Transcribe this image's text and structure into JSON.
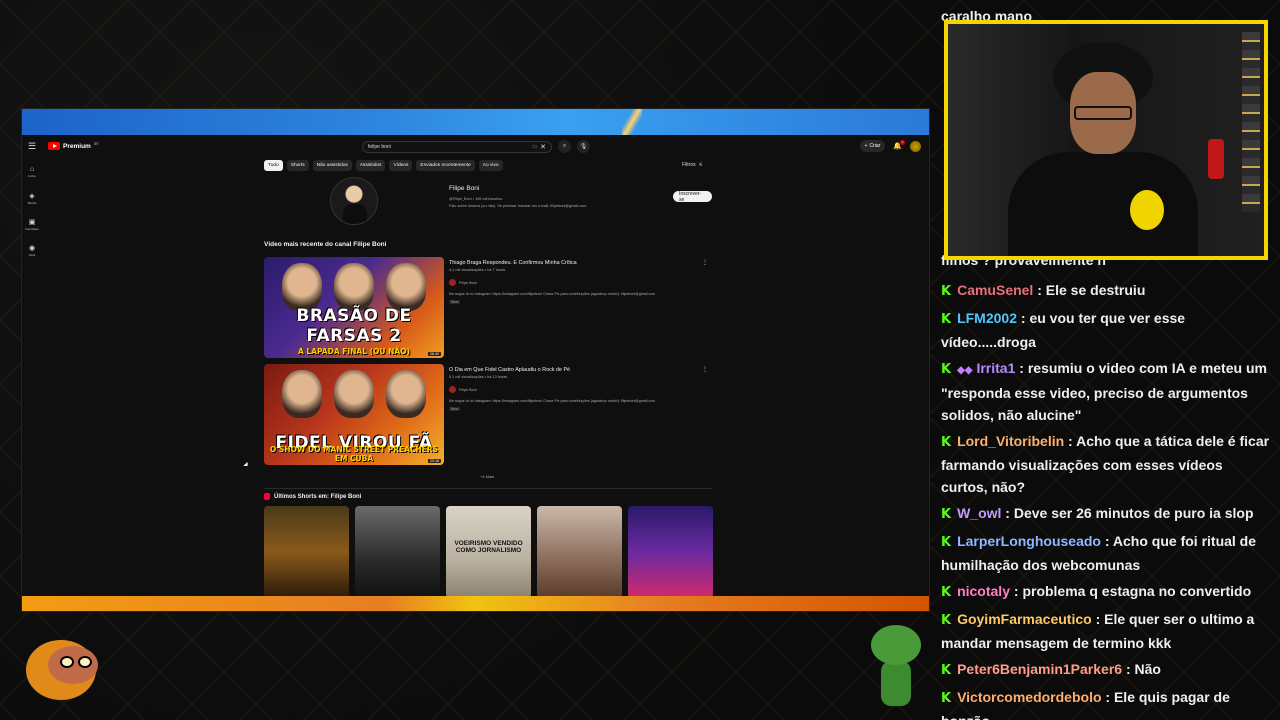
{
  "browser": {
    "youtube": {
      "logo_text": "Premium",
      "logo_sup": "BR",
      "search_query": "felipe boni",
      "create_label": "Criar",
      "notification_count": "9",
      "sidebar": [
        {
          "icon": "⌂",
          "label": "Início"
        },
        {
          "icon": "◈",
          "label": "Shorts"
        },
        {
          "icon": "▣",
          "label": "Inscrições"
        },
        {
          "icon": "◉",
          "label": "Você"
        }
      ],
      "chips": [
        "Tudo",
        "Shorts",
        "Não assistidos",
        "Assistidos",
        "Vídeos",
        "Enviados recentemente",
        "Ao vivo"
      ],
      "filters_label": "Filtros",
      "channel": {
        "name": "Filipe Boni",
        "meta": "@Filipe_Boni • 169 mil inscritos",
        "desc": "Falo sobre música (ou não). Se precisar mandar um e-mail: filipeboni@gmail.com",
        "subscribe_label": "Inscrever-se"
      },
      "latest_title": "Vídeo mais recente do canal Filipe Boni",
      "videos": [
        {
          "title": "Thiago Braga Respondeu. E Confirmou Minha Crítica",
          "meta": "4,1 mil visualizações • há 7 horas",
          "channel": "Filipe Boni",
          "desc": "Me segue lá no Instagram: https://instagram.com/filipeboni Chave Pix para contribuições (agradeço muito!): filipeboni@gmail.com",
          "badge": "Novo",
          "thumb_title": "BRASÃO DE FARSAS 2",
          "thumb_sub": "A LAPADA FINAL (OU NÃO)",
          "duration": "26:40"
        },
        {
          "title": "O Dia em Que Fidel Castro Aplaudiu o Rock de Pé",
          "meta": "5,1 mil visualizações • há 13 horas",
          "channel": "Filipe Boni",
          "desc": "Me segue lá no Instagram: https://instagram.com/filipeboni Chave Pix para contribuições (agradeço muito!): filipeboni@gmail.com",
          "badge": "Novo",
          "thumb_title": "FIDEL VIROU FÃ",
          "thumb_sub": "O SHOW DO MANIC STREET PREACHERS EM CUBA",
          "duration": "20:18"
        }
      ],
      "more_label": "+4 Mais",
      "shorts_title": "Últimos Shorts em: Filipe Boni",
      "shorts_text_3": "VOEIRISMO VENDIDO COMO JORNALISMO"
    }
  },
  "chat": {
    "top_partial": "caralho mano",
    "partial_line": "filhos ? provavelmente n",
    "messages": [
      {
        "user": "CamuSenel",
        "color": "#e8707a",
        "text": "Ele se destruiu"
      },
      {
        "user": "LFM2002",
        "color": "#53c7ff",
        "text": "eu vou ter que ver esse vídeo.....droga"
      },
      {
        "user": "Irrita1",
        "color": "#b48cff",
        "text": "resumiu o video com IA e meteu um \"responda esse video, preciso de argumentos solidos, não alucine\"",
        "badge": "◆◆"
      },
      {
        "user": "Lord_Vitoribelin",
        "color": "#ffb070",
        "text": "Acho que a tática dele é ficar farmando visualizações com esses vídeos curtos, não?"
      },
      {
        "user": "W_owl",
        "color": "#c39bff",
        "text": "Deve ser 26 minutos de puro ia slop"
      },
      {
        "user": "LarperLonghouseado",
        "color": "#8fb8ff",
        "text": "Acho que foi ritual de humilhação dos webcomunas"
      },
      {
        "user": "nicotaly",
        "color": "#ff80c0",
        "text": "problema q estagna no convertido"
      },
      {
        "user": "GoyimFarmaceutico",
        "color": "#ffc966",
        "text": "Ele quer ser o ultimo a mandar mensagem de termino kkk"
      },
      {
        "user": "Peter6Benjamin1Parker6",
        "color": "#ff9d8a",
        "text": "Não"
      },
      {
        "user": "Victorcomedordebolo",
        "color": "#ffae6b",
        "text": "Ele quis pagar de bonzão"
      }
    ]
  }
}
